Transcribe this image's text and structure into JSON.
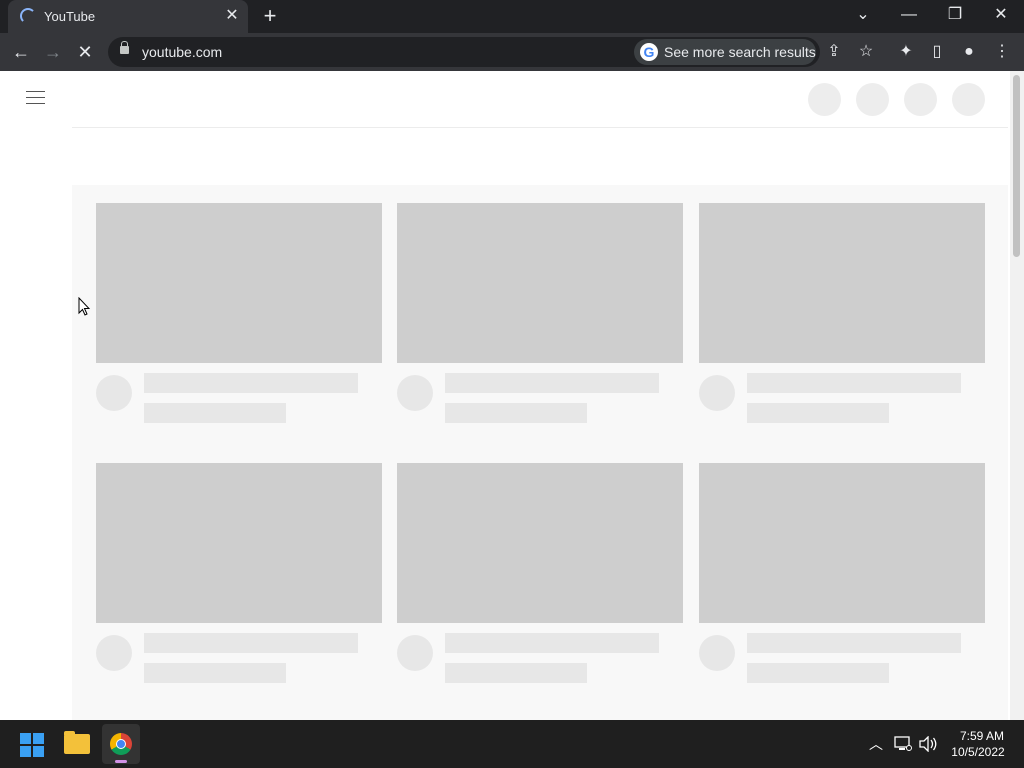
{
  "browser": {
    "tab": {
      "title": "YouTube",
      "close_glyph": "✕"
    },
    "new_tab_glyph": "+",
    "window_controls": {
      "tab_search": "⌄",
      "minimize": "—",
      "restore": "❐",
      "close": "✕"
    },
    "nav": {
      "back": "←",
      "forward": "→",
      "stop": "✕"
    },
    "omnibox": {
      "url": "youtube.com",
      "search_chip": "See more search results"
    },
    "toolbar_icons": {
      "share": "⇪",
      "bookmark": "☆",
      "extensions": "✦",
      "side_panel": "▯",
      "profile": "●",
      "menu": "⋮"
    }
  },
  "taskbar": {
    "tray_chevron": "︿",
    "clock": {
      "time": "7:59 AM",
      "date": "10/5/2022"
    }
  }
}
